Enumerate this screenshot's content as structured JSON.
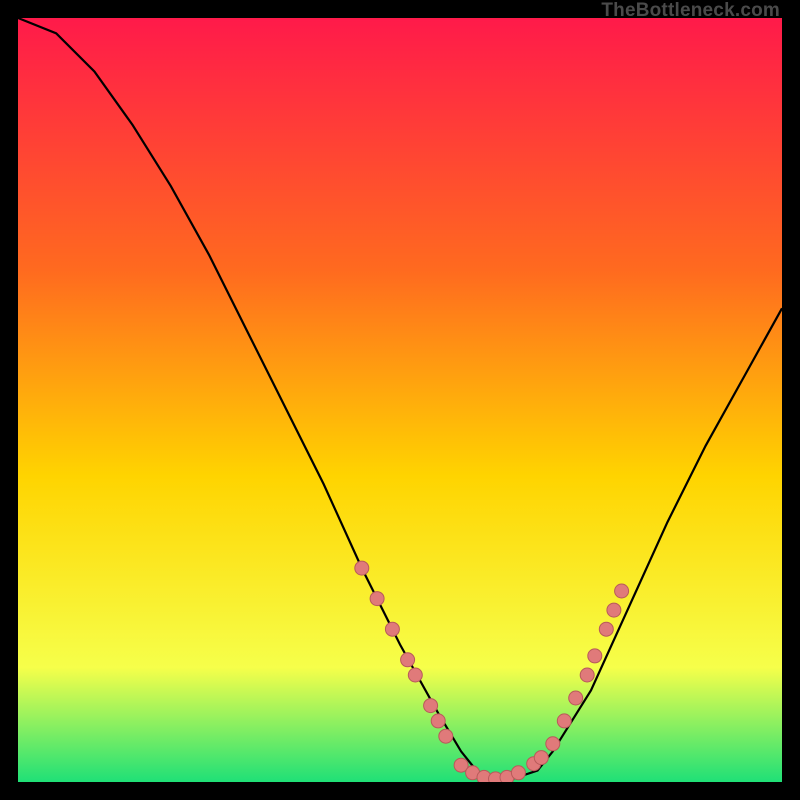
{
  "watermark": "TheBottleneck.com",
  "colors": {
    "gradient_top": "#ff1a4a",
    "gradient_mid1": "#ff6a1f",
    "gradient_mid2": "#ffd400",
    "gradient_low": "#f6ff4a",
    "gradient_bottom": "#1fe077",
    "curve": "#000000",
    "marker_fill": "#e07a7a",
    "marker_stroke": "#b85a5a"
  },
  "chart_data": {
    "type": "line",
    "title": "",
    "xlabel": "",
    "ylabel": "",
    "xlim": [
      0,
      100
    ],
    "ylim": [
      0,
      100
    ],
    "grid": false,
    "legend": false,
    "series": [
      {
        "name": "curve",
        "x": [
          0,
          5,
          10,
          15,
          20,
          25,
          30,
          35,
          40,
          45,
          50,
          55,
          58,
          60,
          62,
          65,
          68,
          70,
          75,
          80,
          85,
          90,
          95,
          100
        ],
        "y": [
          100,
          98,
          93,
          86,
          78,
          69,
          59,
          49,
          39,
          28,
          18,
          9,
          4,
          1.5,
          0.5,
          0.5,
          1.5,
          4,
          12,
          23,
          34,
          44,
          53,
          62
        ]
      }
    ],
    "markers_left": [
      {
        "x": 45,
        "y": 28
      },
      {
        "x": 47,
        "y": 24
      },
      {
        "x": 49,
        "y": 20
      },
      {
        "x": 51,
        "y": 16
      },
      {
        "x": 52,
        "y": 14
      },
      {
        "x": 54,
        "y": 10
      },
      {
        "x": 55,
        "y": 8
      },
      {
        "x": 56,
        "y": 6
      }
    ],
    "markers_bottom": [
      {
        "x": 58,
        "y": 2.2
      },
      {
        "x": 59.5,
        "y": 1.2
      },
      {
        "x": 61,
        "y": 0.6
      },
      {
        "x": 62.5,
        "y": 0.4
      },
      {
        "x": 64,
        "y": 0.6
      },
      {
        "x": 65.5,
        "y": 1.2
      },
      {
        "x": 67.5,
        "y": 2.4
      },
      {
        "x": 68.5,
        "y": 3.2
      }
    ],
    "markers_right": [
      {
        "x": 70,
        "y": 5
      },
      {
        "x": 71.5,
        "y": 8
      },
      {
        "x": 73,
        "y": 11
      },
      {
        "x": 74.5,
        "y": 14
      },
      {
        "x": 75.5,
        "y": 16.5
      },
      {
        "x": 77,
        "y": 20
      },
      {
        "x": 78,
        "y": 22.5
      },
      {
        "x": 79,
        "y": 25
      }
    ]
  }
}
